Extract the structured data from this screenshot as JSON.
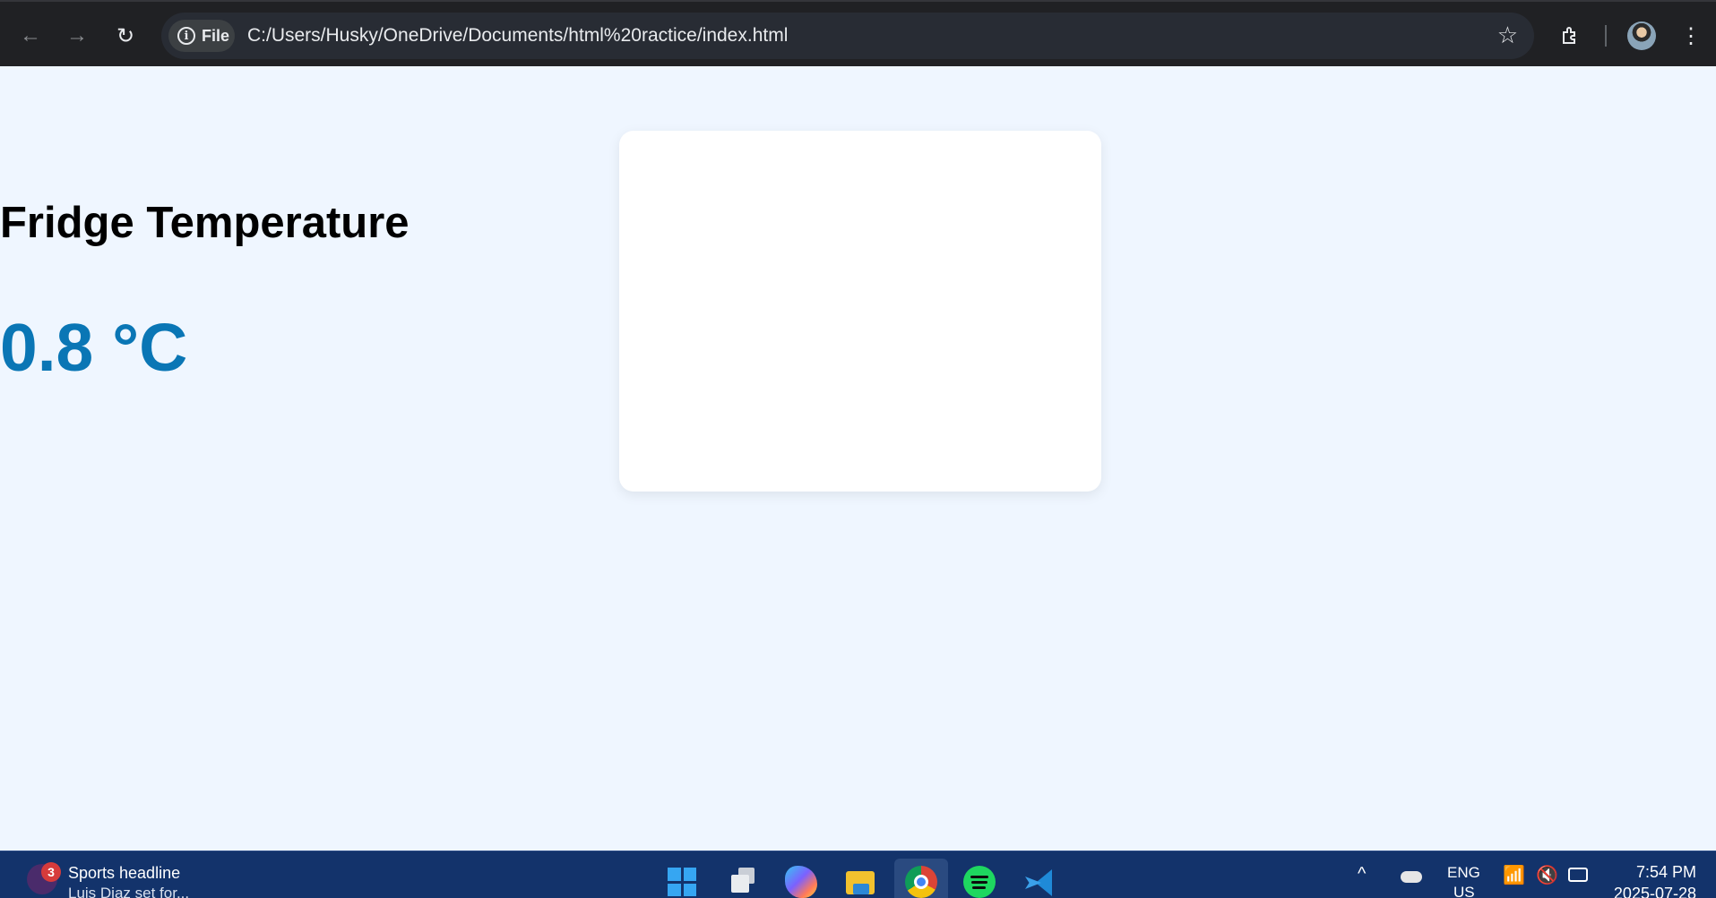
{
  "browser": {
    "site_info_label": "File",
    "url": "C:/Users/Husky/OneDrive/Documents/html%20ractice/index.html",
    "icons": [
      "back-arrow-icon",
      "forward-arrow-icon",
      "reload-icon",
      "info-icon",
      "star-icon",
      "extensions-icon",
      "profile-avatar",
      "kebab-menu-icon"
    ]
  },
  "page": {
    "title": "Fridge Temperature",
    "temperature": "0.8 °C",
    "colors": {
      "background": "#eff6ff",
      "temperature_text": "#0a76b5",
      "card": "#ffffff"
    }
  },
  "taskbar": {
    "news": {
      "badge": "3",
      "title": "Sports headline",
      "subtitle": "Luis Diaz set for..."
    },
    "apps": [
      "windows-start",
      "task-view",
      "copilot",
      "file-explorer",
      "chrome",
      "spotify",
      "vscode"
    ],
    "tray": {
      "lang_line1": "ENG",
      "lang_line2": "US",
      "time": "7:54 PM",
      "date": "2025-07-28"
    }
  }
}
